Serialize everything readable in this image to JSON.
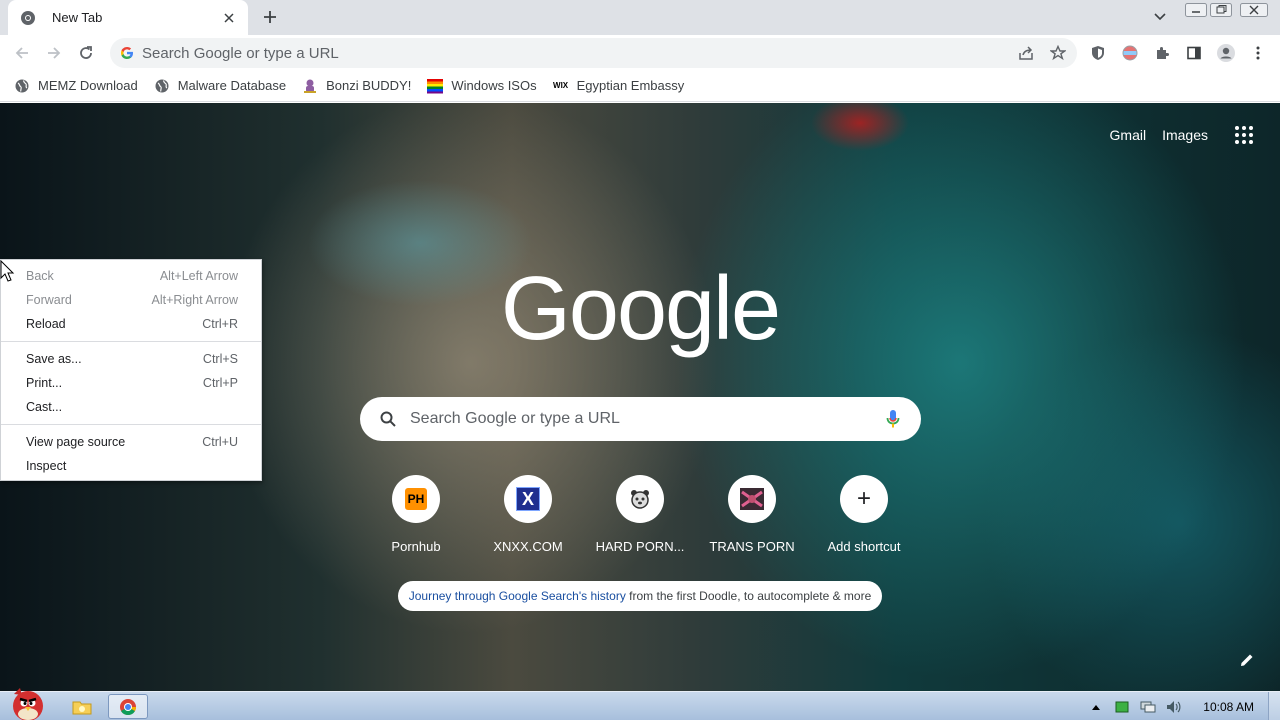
{
  "browser": {
    "tab": {
      "title": "New Tab",
      "favicon": "chrome-logo-icon",
      "close_icon": "close-icon"
    },
    "newtab_icon": "plus-icon",
    "window_controls": [
      "minimize-icon",
      "restore-icon",
      "close-icon"
    ],
    "omnibox": {
      "placeholder": "Search Google or type a URL"
    },
    "toolbar_icons": [
      "back-icon",
      "forward-icon",
      "reload-icon",
      "share-icon",
      "star-icon",
      "shield-icon",
      "extension-icon",
      "puzzle-icon",
      "sidepanel-icon",
      "profile-icon",
      "menu-icon"
    ]
  },
  "bookmarks": [
    {
      "label": "MEMZ Download",
      "icon": "globe-icon"
    },
    {
      "label": "Malware Database",
      "icon": "globe-icon"
    },
    {
      "label": "Bonzi BUDDY!",
      "icon": "bonzi-icon"
    },
    {
      "label": "Windows ISOs",
      "icon": "windows-flag-icon"
    },
    {
      "label": "Egyptian Embassy",
      "icon": "wix-icon"
    }
  ],
  "ntp": {
    "gmail_label": "Gmail",
    "images_label": "Images",
    "logo_text": "Google",
    "search_placeholder": "Search Google or type a URL",
    "shortcuts": [
      {
        "label": "Pornhub",
        "tile_text": "PH"
      },
      {
        "label": "XNXX.COM",
        "tile_text": "X"
      },
      {
        "label": "HARD PORN...",
        "tile_text": ""
      },
      {
        "label": "TRANS PORN",
        "tile_text": ""
      },
      {
        "label": "Add shortcut",
        "tile_text": "+"
      }
    ],
    "promo": {
      "link_text": "Journey through Google Search's history",
      "rest_text": " from the first Doodle, to autocomplete & more"
    }
  },
  "context_menu": {
    "items": [
      {
        "label": "Back",
        "accelerator": "Alt+Left Arrow",
        "disabled": true
      },
      {
        "label": "Forward",
        "accelerator": "Alt+Right Arrow",
        "disabled": true
      },
      {
        "label": "Reload",
        "accelerator": "Ctrl+R",
        "disabled": false
      },
      {
        "label": "Save as...",
        "accelerator": "Ctrl+S",
        "disabled": false
      },
      {
        "label": "Print...",
        "accelerator": "Ctrl+P",
        "disabled": false
      },
      {
        "label": "Cast...",
        "accelerator": "",
        "disabled": false
      },
      {
        "label": "View page source",
        "accelerator": "Ctrl+U",
        "disabled": false
      },
      {
        "label": "Inspect",
        "accelerator": "",
        "disabled": false
      }
    ]
  },
  "taskbar": {
    "clock": "10:08 AM",
    "apps": [
      "explorer-icon",
      "chrome-icon"
    ],
    "tray_icons": [
      "show-hidden-icons-arrow",
      "battery-icon",
      "network-icon",
      "volume-icon"
    ]
  },
  "colors": {
    "tabstrip": "#dee1e6",
    "link": "#1a4fa0",
    "taskbar": "#b8cce4"
  }
}
